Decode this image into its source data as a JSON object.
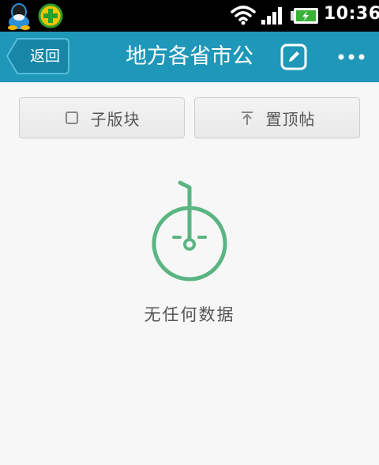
{
  "status_bar": {
    "time": "10:36",
    "icons": [
      "qq-icon",
      "plus-app-icon",
      "wifi-icon",
      "signal-icon",
      "battery-charging-icon"
    ]
  },
  "header": {
    "back_label": "返回",
    "title": "地方各省市公",
    "edit_icon": "edit-icon",
    "more_icon": "more-icon",
    "color": "#1f97b9"
  },
  "tabs": [
    {
      "label": "子版块",
      "icon": "square-icon"
    },
    {
      "label": "置顶帖",
      "icon": "pin-top-icon"
    }
  ],
  "empty_state": {
    "message": "无任何数据",
    "icon": "unicycle-face-icon",
    "accent": "#5bb583"
  }
}
